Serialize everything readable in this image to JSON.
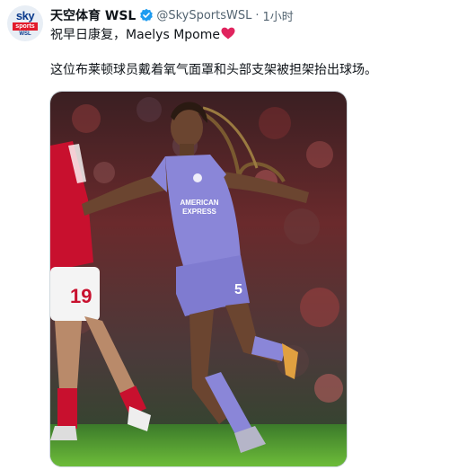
{
  "tweet": {
    "avatar": {
      "line1": "sky",
      "line2": "sports",
      "line3": "WSL"
    },
    "display_name": "天空体育 WSL",
    "verified_icon": "verified-badge-icon",
    "handle": "@SkySportsWSL",
    "separator": "·",
    "time": "1小时",
    "text_line1": "祝早日康复，Maelys Mpome",
    "heart_icon": "red-heart-icon",
    "text_line2": "这位布莱顿球员戴着氧气面罩和头部支架被担架抬出球场。",
    "photo": {
      "kit_text1": "AMERICAN",
      "kit_text2": "EXPRESS",
      "shorts_number": "5",
      "opponent_number": "19"
    }
  },
  "colors": {
    "brand_blue": "#0a3a8c",
    "brand_red": "#e21b2b",
    "verified_blue": "#1d9bf0",
    "kit_lilac": "#8a86d8",
    "arsenal_red": "#c8102e"
  }
}
